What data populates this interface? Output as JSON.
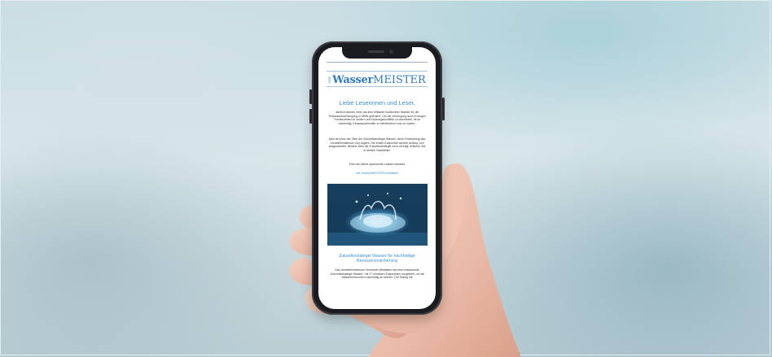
{
  "newsletter": {
    "logo_der": "DER",
    "logo_wasser": "Wasser",
    "logo_meister": "MEISTER",
    "heading": "Liebe Leserinnen und Leser,",
    "para1": "Jährlich werden mehr als eine Milliarde Kubikmeter Wasser für die Trinkwasserversorgung in NRW gefördert. Um die Versorgung auch in langen Trockenzeiten zu sichern und Nutzungskonflikte zu vermeiden, ist es notwendig, Einsparpotenziale zu identifizieren und zu nutzen.",
    "para2": "Dies ist eines der Ziele der Zukunftsstrategie Wasser, deren Erarbeitung das Umweltministerium nun angeht. Die ersten Eckpunkte werden Anfang Juni ausgearbeitet. Welche Ziele die Zukunftsstrategie noch verfolgt, erfahren Sie in diesem Newsletter.",
    "closing": "Eine wie immer spannende Lektüre wünscht",
    "signature": "Ihre WasserMEISTER-Redaktion",
    "article_title": "Zukunftsstrategie Wasser für nachhaltige Ressourcensicherung",
    "article_text": "Das Umweltministerium Nordrhein-Westfalen hat eine umfassende „Zukunftsstrategie Wasser“ mit 17 zentralen Eckpunkten vorgestellt, um die Wasserressourcen nachhaltig zu sichern. Der Dialog mit"
  },
  "colors": {
    "accent": "#3b8fd4",
    "phone_frame": "#1b1c1f",
    "background": "#d3e3e8"
  }
}
